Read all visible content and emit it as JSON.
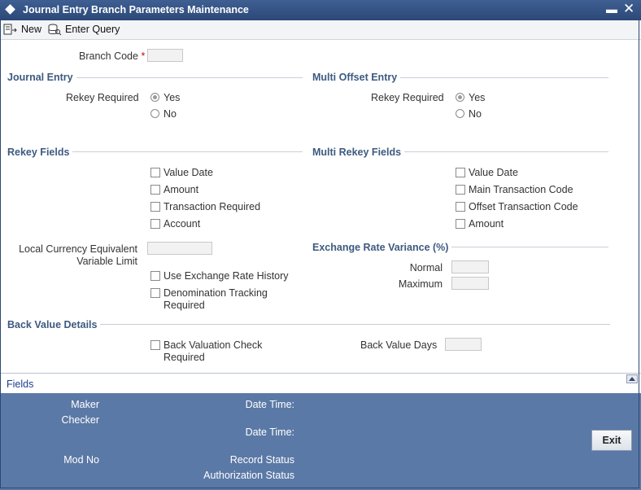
{
  "window": {
    "title": "Journal Entry Branch Parameters Maintenance",
    "minimize": "▬",
    "close": "✕"
  },
  "toolbar": {
    "new_label": "New",
    "enter_query_label": "Enter Query"
  },
  "branch_code": {
    "label": "Branch Code",
    "required_mark": "*",
    "value": ""
  },
  "journal_entry": {
    "title": "Journal Entry",
    "rekey_label": "Rekey Required",
    "options": [
      {
        "label": "Yes",
        "checked": true
      },
      {
        "label": "No",
        "checked": false
      }
    ]
  },
  "multi_offset_entry": {
    "title": "Multi Offset Entry",
    "rekey_label": "Rekey Required",
    "options": [
      {
        "label": "Yes",
        "checked": true
      },
      {
        "label": "No",
        "checked": false
      }
    ]
  },
  "rekey_fields": {
    "title": "Rekey Fields",
    "items": [
      {
        "label": "Value Date"
      },
      {
        "label": "Amount"
      },
      {
        "label": "Transaction Required"
      },
      {
        "label": "Account"
      }
    ]
  },
  "multi_rekey_fields": {
    "title": "Multi Rekey Fields",
    "items": [
      {
        "label": "Value Date"
      },
      {
        "label": "Main Transaction Code"
      },
      {
        "label": "Offset Transaction Code"
      },
      {
        "label": "Amount"
      }
    ]
  },
  "local_currency": {
    "label_line1": "Local Currency Equivalent",
    "label_line2": "Variable Limit",
    "value": ""
  },
  "options": {
    "exchange_rate_history": "Use Exchange Rate History",
    "denomination_line1": "Denomination Tracking",
    "denomination_line2": "Required"
  },
  "exchange_rate_variance": {
    "title": "Exchange Rate Variance (%)",
    "normal_label": "Normal",
    "maximum_label": "Maximum",
    "normal_value": "",
    "maximum_value": ""
  },
  "back_value": {
    "title": "Back Value Details",
    "check_line1": "Back Valuation Check",
    "check_line2": "Required",
    "days_label": "Back Value Days",
    "days_value": ""
  },
  "fields_bar": {
    "label": "Fields"
  },
  "footer": {
    "maker": "Maker",
    "checker": "Checker",
    "date_time_1": "Date Time:",
    "date_time_2": "Date Time:",
    "mod_no": "Mod No",
    "record_status": "Record Status",
    "authorization_status": "Authorization Status",
    "exit_label": "Exit"
  },
  "colors": {
    "title_bar": "#2b4877",
    "section_title": "#3d5a80",
    "footer": "#5b79a6",
    "required": "#cc0000"
  },
  "icons": {
    "new": "new-document-icon",
    "enter_query": "query-icon",
    "window": "diamond-icon"
  }
}
